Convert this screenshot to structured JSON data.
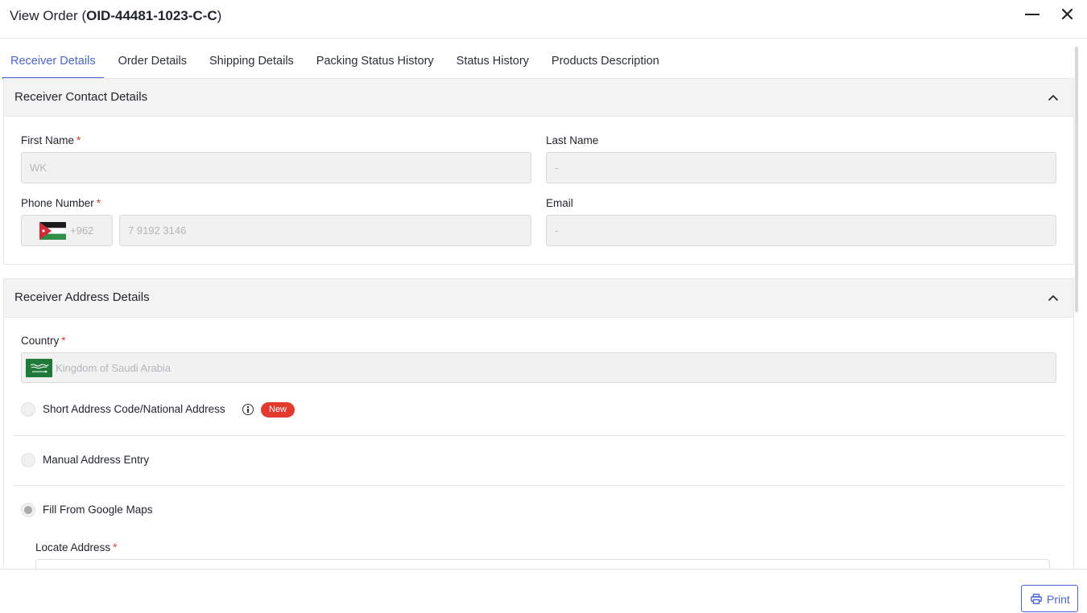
{
  "header": {
    "title_prefix": "View Order (",
    "order_id": "OID-44481-1023-C-C",
    "title_suffix": ")"
  },
  "tabs": [
    {
      "label": "Receiver Details",
      "active": true
    },
    {
      "label": "Order Details"
    },
    {
      "label": "Shipping Details"
    },
    {
      "label": "Packing Status History"
    },
    {
      "label": "Status History"
    },
    {
      "label": "Products Description"
    }
  ],
  "contact_section": {
    "title": "Receiver Contact Details",
    "first_name": {
      "label": "First Name",
      "required": "*",
      "value": "WK"
    },
    "last_name": {
      "label": "Last Name",
      "value": "-"
    },
    "phone": {
      "label": "Phone Number",
      "required": "*",
      "country_code": "+962",
      "number": "7 9192 3146"
    },
    "email": {
      "label": "Email",
      "value": "-"
    }
  },
  "address_section": {
    "title": "Receiver Address Details",
    "country": {
      "label": "Country",
      "required": "*",
      "value": "Kingdom of Saudi Arabia"
    },
    "options": [
      {
        "label": "Short Address Code/National Address",
        "badge": "New"
      },
      {
        "label": "Manual Address Entry"
      },
      {
        "label": "Fill From Google Maps",
        "selected": true
      }
    ],
    "locate": {
      "label": "Locate Address",
      "required": "*"
    }
  },
  "footer": {
    "print_label": "Print"
  },
  "colors": {
    "accent": "#4a63d6",
    "required": "#e03a2f",
    "badge": "#e43a2e"
  },
  "icons": [
    "minimize-icon",
    "close-icon",
    "chevron-up-icon",
    "info-icon",
    "printer-icon",
    "jordan-flag-icon",
    "saudi-flag-icon"
  ]
}
